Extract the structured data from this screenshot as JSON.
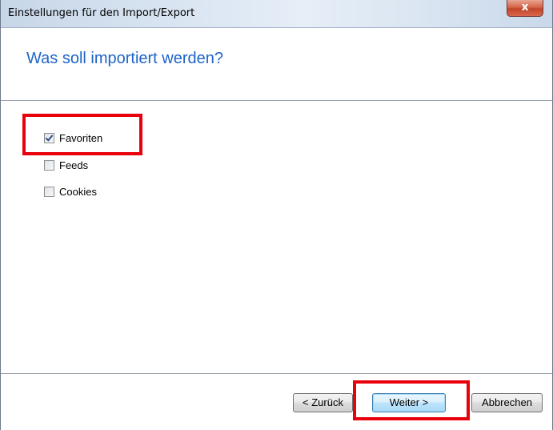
{
  "window": {
    "title": "Einstellungen für den Import/Export",
    "close_label": "x"
  },
  "header": {
    "title": "Was soll importiert werden?"
  },
  "options": [
    {
      "label": "Favoriten",
      "checked": true
    },
    {
      "label": "Feeds",
      "checked": false
    },
    {
      "label": "Cookies",
      "checked": false
    }
  ],
  "footer": {
    "back_label": "< Zurück",
    "next_label": "Weiter >",
    "cancel_label": "Abbrechen"
  },
  "colors": {
    "title_text": "#1e64c8",
    "highlight": "#e8000b"
  }
}
